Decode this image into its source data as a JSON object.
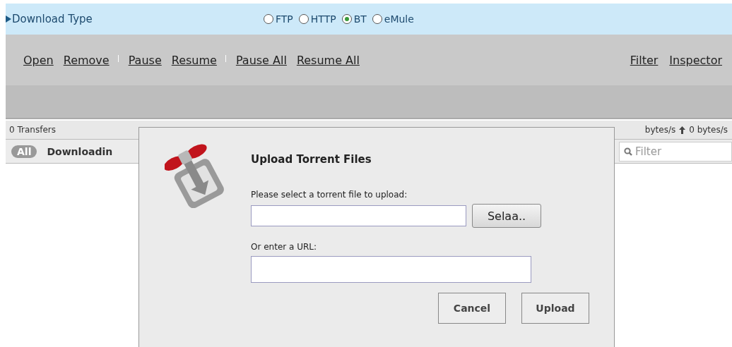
{
  "download_type": {
    "label": "Download Type",
    "options": [
      {
        "label": "FTP",
        "selected": false
      },
      {
        "label": "HTTP",
        "selected": false
      },
      {
        "label": "BT",
        "selected": true
      },
      {
        "label": "eMule",
        "selected": false
      }
    ]
  },
  "toolbar": {
    "left": [
      {
        "label": "Open",
        "divider_after": false
      },
      {
        "label": "Remove",
        "divider_after": true
      },
      {
        "label": "Pause",
        "divider_after": false
      },
      {
        "label": "Resume",
        "divider_after": true
      },
      {
        "label": "Pause All",
        "divider_after": false
      },
      {
        "label": "Resume All",
        "divider_after": false
      }
    ],
    "right": [
      {
        "label": "Filter"
      },
      {
        "label": "Inspector"
      }
    ]
  },
  "status_bar": {
    "transfers": "0 Transfers",
    "download_speed": "bytes/s",
    "upload_speed": "0 bytes/s"
  },
  "filter_bar": {
    "tabs": [
      {
        "label": "All",
        "selected": true
      },
      {
        "label": "Downloadin",
        "selected": false
      }
    ],
    "search": {
      "placeholder": "Filter"
    }
  },
  "dialog": {
    "title": "Upload Torrent Files",
    "file_label": "Please select a torrent file to upload:",
    "browse_button": "Selaa..",
    "url_label": "Or enter a URL:",
    "buttons": [
      "Cancel",
      "Upload"
    ]
  }
}
